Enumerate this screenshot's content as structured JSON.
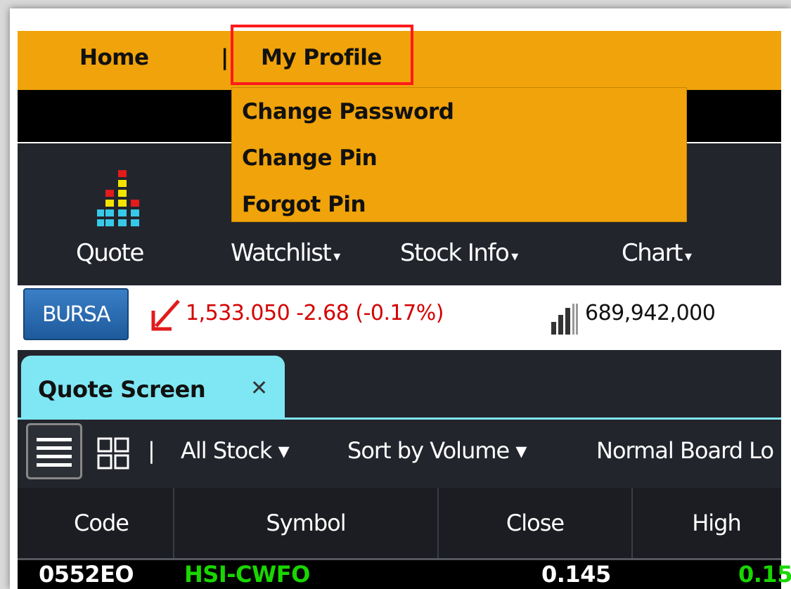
{
  "top_nav": {
    "home": "Home",
    "separator": "|",
    "my_profile": "My Profile",
    "dropdown": [
      "Change Password",
      "Change Pin",
      "Forgot Pin"
    ]
  },
  "toolbar": {
    "quote": "Quote",
    "watchlist": "Watchlist",
    "stock_info": "Stock Info",
    "chart": "Chart",
    "caret": "▾"
  },
  "index_bar": {
    "market_button": "BURSA",
    "index_value": "1,533.050 -2.68 (-0.17%)",
    "volume": "689,942,000"
  },
  "tabs": [
    {
      "label": "Quote Screen",
      "close": "✕"
    }
  ],
  "filter_bar": {
    "all_stock": "All Stock ▾",
    "sort": "Sort by Volume ▾",
    "board": "Normal Board Lo",
    "separator": "|"
  },
  "table": {
    "columns": [
      "Code",
      "Symbol",
      "Close",
      "High"
    ],
    "rows": [
      {
        "code": "0552EO",
        "symbol": "HSI-CWFO",
        "close": "0.145",
        "high": "0.15"
      }
    ]
  },
  "colors": {
    "accent": "#f0a30a",
    "tab": "#7fe6f3",
    "negative": "#d40000",
    "symbol": "#19d600",
    "highlight": "#ff1a1a"
  }
}
